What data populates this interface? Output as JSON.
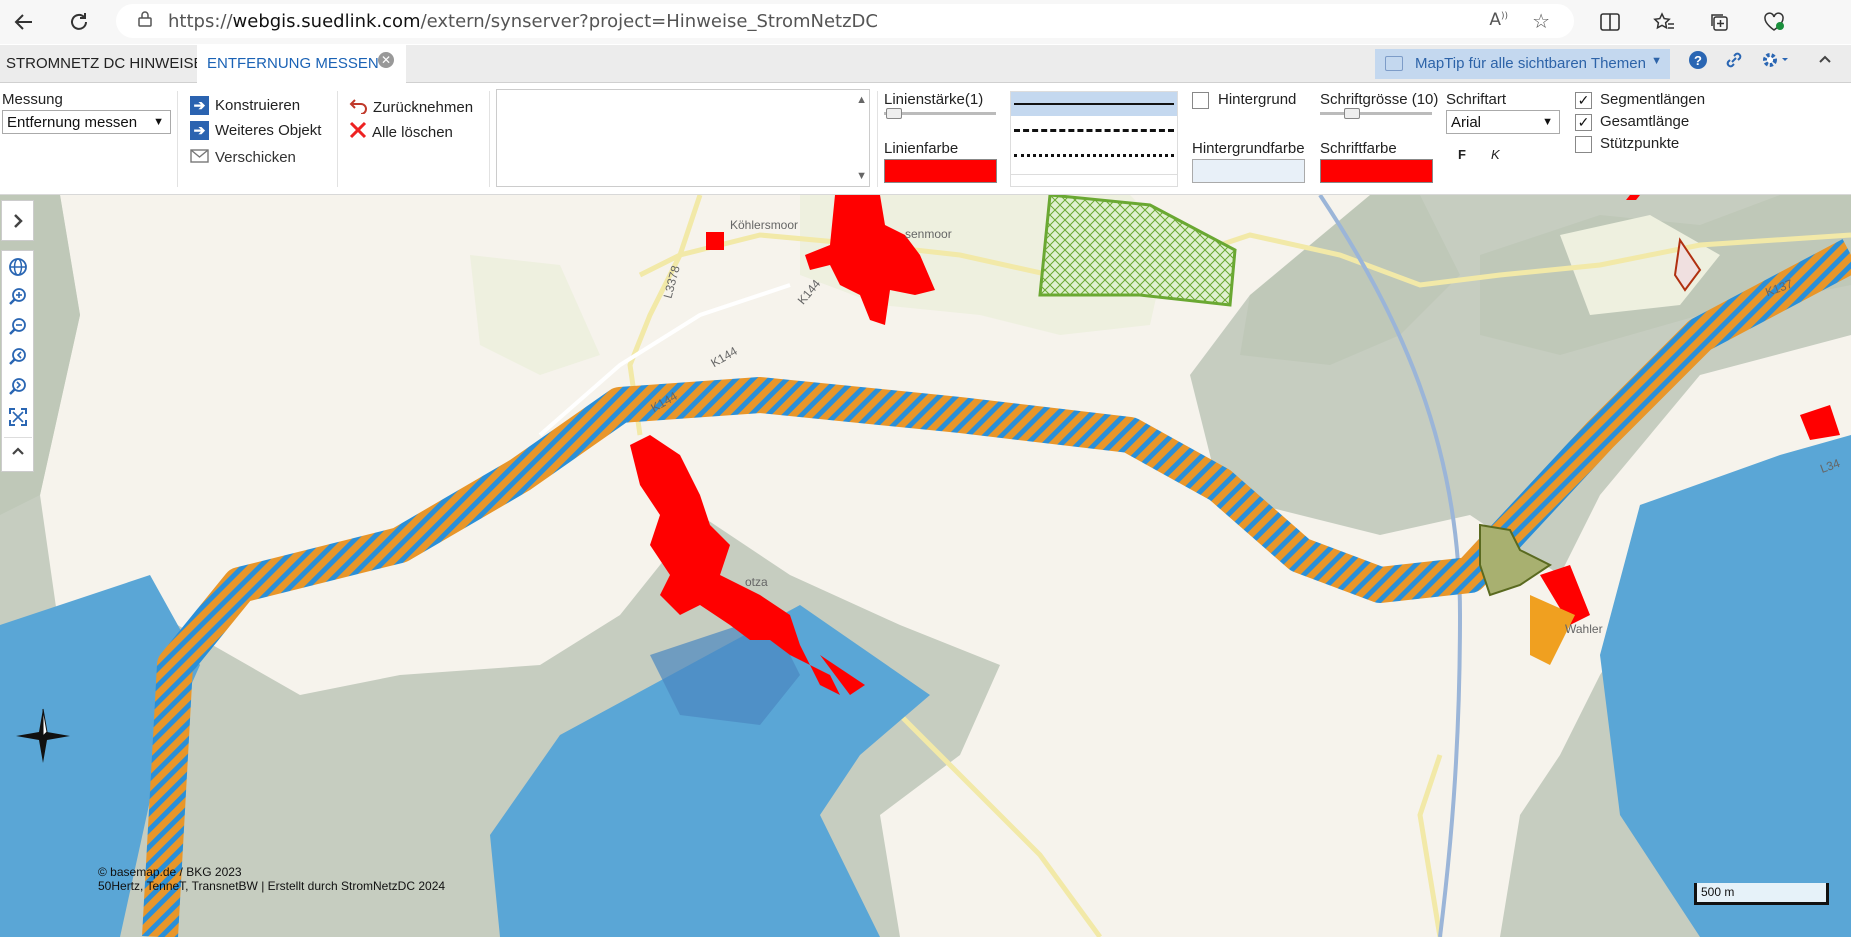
{
  "browser": {
    "url_prefix": "https://",
    "url_host": "webgis.suedlink.com",
    "url_path": "/extern/synserver?project=Hinweise_StromNetzDC"
  },
  "tabs": {
    "tab1": "STROMNETZ DC HINWEISE",
    "tab2": "ENTFERNUNG MESSEN"
  },
  "maptip": {
    "label": "MapTip für alle sichtbaren Themen"
  },
  "toolbar": {
    "messung_label": "Messung",
    "messung_value": "Entfernung messen",
    "konstruieren": "Konstruieren",
    "weiteres_objekt": "Weiteres Objekt",
    "verschicken": "Verschicken",
    "zuruecknehmen": "Zurücknehmen",
    "alle_loeschen": "Alle löschen",
    "linienstaerke": "Linienstärke(1)",
    "linienfarbe": "Linienfarbe",
    "linienfarbe_color": "#ff0000",
    "hintergrund": "Hintergrund",
    "hintergrundfarbe": "Hintergrundfarbe",
    "hintergrundfarbe_color": "#e8f0f8",
    "schriftgroesse": "Schriftgrösse (10)",
    "schriftfarbe": "Schriftfarbe",
    "schriftfarbe_color": "#ff0000",
    "schriftart": "Schriftart",
    "schriftart_value": "Arial",
    "bold": "F",
    "italic": "K",
    "segmentlaengen": "Segmentlängen",
    "gesamtlaenge": "Gesamtlänge",
    "stuetzpunkte": "Stützpunkte",
    "segmentlaengen_checked": true,
    "gesamtlaenge_checked": true,
    "stuetzpunkte_checked": false
  },
  "map": {
    "places": {
      "koehlersmoor": "Köhlersmoor",
      "senmoor": "senmoor",
      "otza": "otza",
      "ahler": "Wahler"
    },
    "roads": {
      "l3378": "L3378",
      "k144a": "K144",
      "k144b": "K144",
      "k144c": "K144",
      "k137": "K137",
      "l34": "L34"
    },
    "attribution_1": "© basemap.de / BKG 2023",
    "attribution_2": "50Hertz, TenneT, TransnetBW | Erstellt durch StromNetzDC 2024",
    "scale_label": "500 m",
    "colors": {
      "corridor": "#e8962a",
      "corridor_hatch": "#2a8fd8",
      "settlement_red": "#ff0000",
      "water_blue": "#5aa6d6",
      "green_hatch": "#6aa832"
    }
  }
}
